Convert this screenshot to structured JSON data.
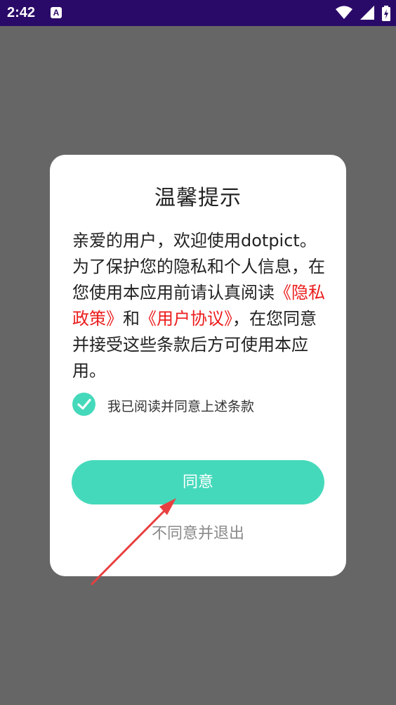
{
  "statusbar": {
    "time": "2:42",
    "app_badge_letter": "A",
    "icons": [
      "wifi-icon",
      "signal-icon",
      "battery-icon"
    ]
  },
  "dialog": {
    "title": "温馨提示",
    "message_part1": "亲爱的用户，欢迎使用dotpict。为了保护您的隐私和个人信息，在您使用本应用前请认真阅读",
    "privacy_link": "《隐私政策》",
    "and_text": "和",
    "agreement_link": "《用户协议》",
    "message_part2": "，在您同意并接受这些条款后方可使用本应用。",
    "checkbox_label": "我已阅读并同意上述条款",
    "checkbox_checked": true,
    "agree_label": "同意",
    "disagree_label": "不同意并退出"
  },
  "colors": {
    "statusbar": "#2a0a68",
    "overlay": "#666666",
    "accent": "#45d9bb",
    "link": "#ec1c1c",
    "annotation_arrow": "#e84040"
  }
}
